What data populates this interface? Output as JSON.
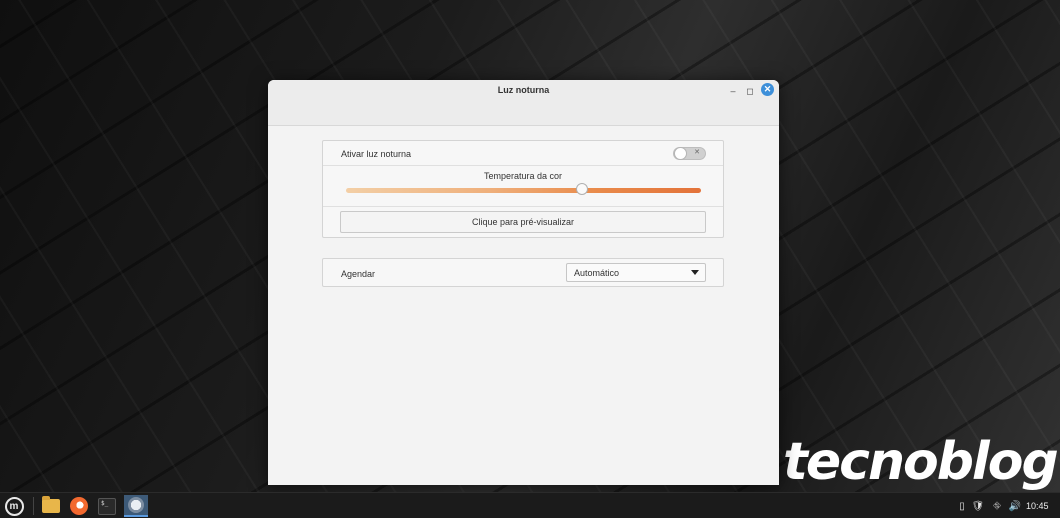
{
  "window": {
    "title": "Luz noturna",
    "minimize_icon": "minimize-icon",
    "maximize_icon": "maximize-icon",
    "close_icon": "close-icon",
    "accent_color": "#3d8fd9"
  },
  "night_light": {
    "toggle_label": "Ativar luz noturna",
    "enabled": false,
    "temperature_label": "Temperatura da cor",
    "temperature_fraction": 0.665,
    "preview_button": "Clique para pré-visualizar"
  },
  "schedule": {
    "label": "Agendar",
    "selected": "Automático"
  },
  "taskbar": {
    "menu_icon": "linux-mint-menu-icon",
    "apps": [
      "files-icon",
      "firefox-icon",
      "terminal-icon",
      "night-light-icon"
    ],
    "tray_icons": [
      "clipboard-icon",
      "shield-icon",
      "network-icon",
      "volume-icon"
    ],
    "clock": "10:45"
  },
  "watermark": "tecnoblog"
}
